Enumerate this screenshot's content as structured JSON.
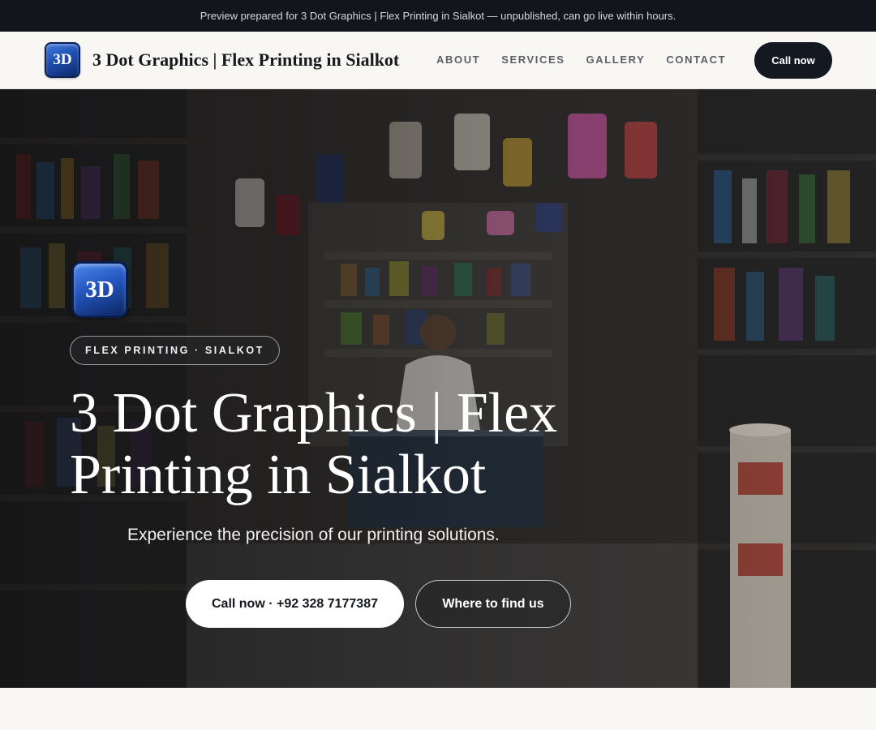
{
  "banner": {
    "text": "Preview prepared for 3 Dot Graphics | Flex Printing in Sialkot — unpublished, can go live within hours."
  },
  "header": {
    "logo_text": "3D",
    "brand_name": "3 Dot Graphics | Flex Printing in Sialkot",
    "nav": [
      {
        "label": "ABOUT"
      },
      {
        "label": "SERVICES"
      },
      {
        "label": "GALLERY"
      },
      {
        "label": "CONTACT"
      }
    ],
    "call_button": "Call now"
  },
  "hero": {
    "logo_text": "3D",
    "eyebrow": "FLEX PRINTING · SIALKOT",
    "title": "3 Dot Graphics | Flex Printing in Sialkot",
    "subtitle": "Experience the precision of our printing solutions.",
    "primary_cta": "Call now · +92 328 7177387",
    "secondary_cta": "Where to find us"
  },
  "colors": {
    "banner_bg": "#12151b",
    "header_bg": "#f8f7f4",
    "dark_button": "#141821",
    "logo_blue": "#2356bf"
  }
}
